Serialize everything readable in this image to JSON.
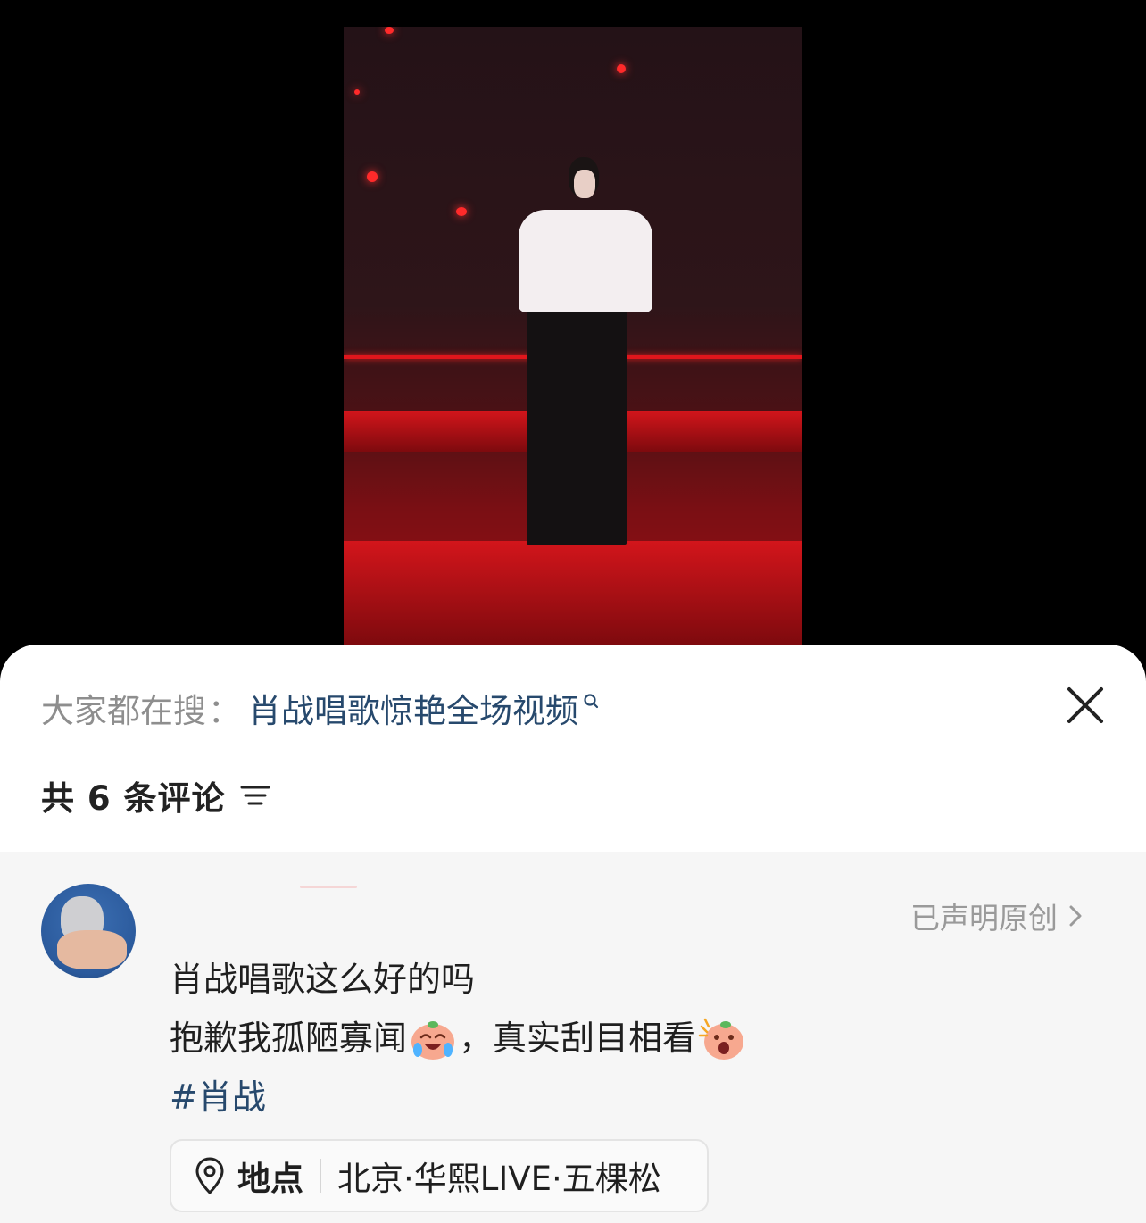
{
  "search": {
    "prefix": "大家都在搜",
    "separator": "：",
    "term": "肖战唱歌惊艳全场视频"
  },
  "comments_header": {
    "count_label": "共 6 条评论"
  },
  "post": {
    "original_badge": "已声明原创",
    "lines": [
      "肖战唱歌这么好的吗",
      "抱歉我孤陋寡闻",
      "，真实刮目相看"
    ],
    "hashtag": "#肖战",
    "location": {
      "label": "地点",
      "value": "北京·华熙LIVE·五棵松"
    }
  },
  "icons": {
    "close": "close-icon",
    "filter": "filter-icon",
    "search": "search-icon",
    "chevron": "chevron-right-icon",
    "location": "location-pin-icon",
    "emoji1": "crying-laughing-peach-emoji",
    "emoji2": "shocked-peach-emoji"
  },
  "colors": {
    "link": "#27496d",
    "muted": "#8e8e8e",
    "sheet_bg": "#ffffff",
    "comment_bg": "#f6f6f6"
  }
}
